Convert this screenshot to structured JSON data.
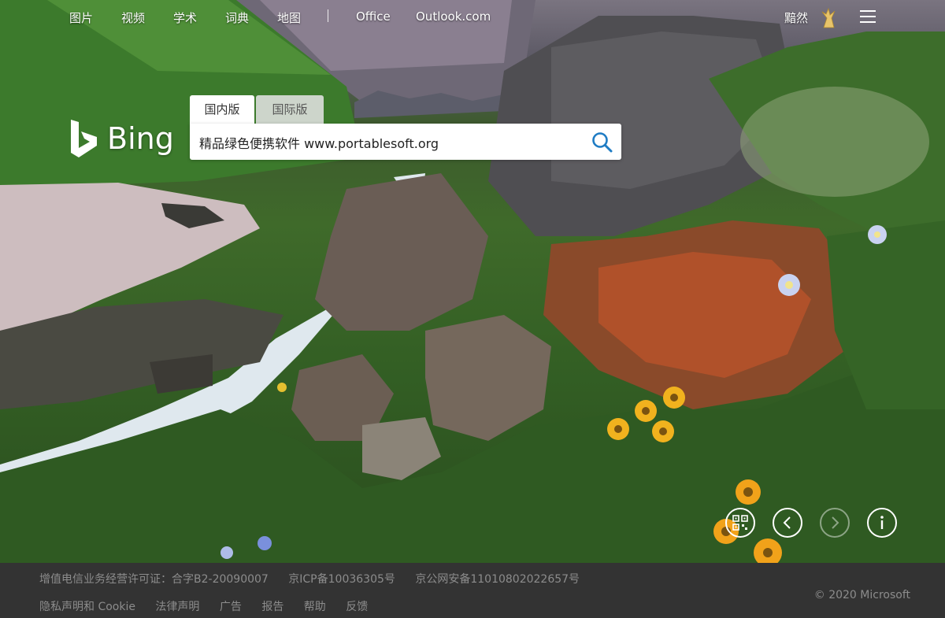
{
  "nav": {
    "items": [
      "图片",
      "视频",
      "学术",
      "词典",
      "地图",
      "Office",
      "Outlook.com"
    ],
    "user_name": "黯然"
  },
  "logo": {
    "text": "Bing"
  },
  "search": {
    "tabs": [
      "国内版",
      "国际版"
    ],
    "active_tab": 0,
    "value": "精品绿色便携软件 www.portablesoft.org"
  },
  "controls": [
    "qr-code-icon",
    "previous-image-icon",
    "next-image-icon",
    "info-icon"
  ],
  "footer": {
    "row1": [
      "增值电信业务经营许可证：合字B2-20090007",
      "京ICP备10036305号",
      "京公网安备11010802022657号"
    ],
    "row2": [
      "隐私声明和 Cookie",
      "法律声明",
      "广告",
      "报告",
      "帮助",
      "反馈"
    ],
    "copyright": "© 2020 Microsoft"
  },
  "colors": {
    "footer_bg": "#333333",
    "footer_text": "#8c8c8c",
    "search_icon": "#1f7cc4"
  }
}
